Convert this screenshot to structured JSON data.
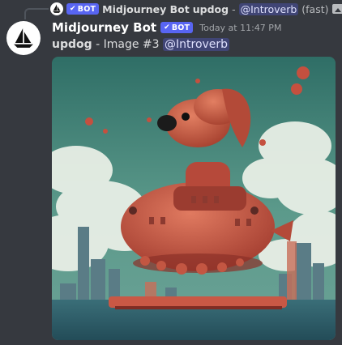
{
  "reply": {
    "bot_badge": "BOT",
    "author": "Midjourney Bot",
    "command": "updog",
    "separator": "-",
    "mention": "@Introverb",
    "suffix": "(fast)"
  },
  "message": {
    "author": "Midjourney Bot",
    "bot_badge": "BOT",
    "timestamp": "Today at 11:47 PM",
    "command": "updog",
    "text": " - Image #3 ",
    "mention": "@Introverb"
  },
  "colors": {
    "background": "#36393f",
    "badge": "#5865f2",
    "mention_bg": "#414675"
  }
}
